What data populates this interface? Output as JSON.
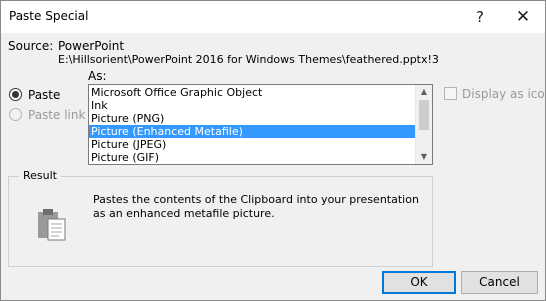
{
  "window": {
    "title": "Paste Special",
    "help_symbol": "?",
    "close_symbol": "✕"
  },
  "source": {
    "label": "Source:",
    "app": "PowerPoint",
    "path": "E:\\Hillsorient\\PowerPoint 2016 for Windows Themes\\feathered.pptx!3"
  },
  "options": {
    "as_label": "As:",
    "paste_label": "Paste",
    "paste_checked": true,
    "paste_link_label": "Paste link",
    "paste_link_enabled": false,
    "display_as_icon_label": "Display as icon",
    "display_as_icon_checked": false
  },
  "as_list": {
    "items": [
      "Microsoft Office Graphic Object",
      "Ink",
      "Picture (PNG)",
      "Picture (Enhanced Metafile)",
      "Picture (JPEG)",
      "Picture (GIF)"
    ],
    "selected": "Picture (Enhanced Metafile)"
  },
  "result": {
    "label": "Result",
    "text": "Pastes the contents of the Clipboard into your presentation as an enhanced metafile picture.",
    "icon": "clipboard-icon"
  },
  "buttons": {
    "ok": "OK",
    "cancel": "Cancel"
  },
  "colors": {
    "selection": "#3399ff",
    "dialog_bg": "#f0f0f0",
    "default_button_border": "#0078d7"
  }
}
